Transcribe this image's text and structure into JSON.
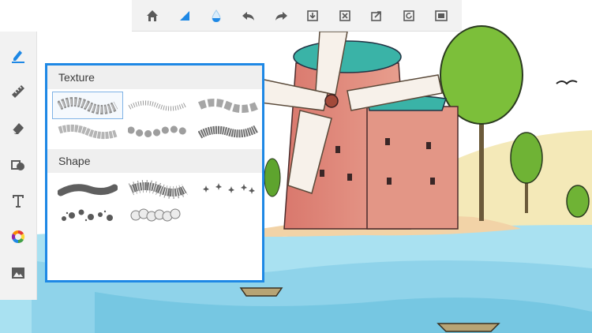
{
  "toolbar": {
    "icons": [
      "home-icon",
      "brush-size-icon",
      "ink-drop-icon",
      "undo-icon",
      "redo-icon",
      "import-icon",
      "clear-canvas-icon",
      "share-icon",
      "rotate-icon",
      "fullscreen-icon"
    ]
  },
  "sidebar": {
    "tools": [
      "pen-tool-icon",
      "ruler-icon",
      "eraser-icon",
      "shapes-icon",
      "text-icon",
      "color-wheel-icon",
      "background-image-icon"
    ],
    "active_tool": "pen-tool-icon"
  },
  "brush_panel": {
    "texture_heading": "Texture",
    "shape_heading": "Shape",
    "texture_brushes": [
      "checker-texture",
      "speckle-texture",
      "square-stamp-texture",
      "block-texture",
      "dot-texture",
      "fuzzy-texture"
    ],
    "shape_brushes": [
      "solid-stroke",
      "spiky-stroke",
      "star-stamp",
      "splat-stamp",
      "circle-stamp"
    ],
    "selected": "checker-texture"
  },
  "colors": {
    "accent": "#1e88e5",
    "icon": "#5a5a5a",
    "water": "#8fd3ea",
    "windmill_walls": "#e08b7d",
    "roof": "#3ab3a7",
    "foliage": "#7cbf3a"
  }
}
